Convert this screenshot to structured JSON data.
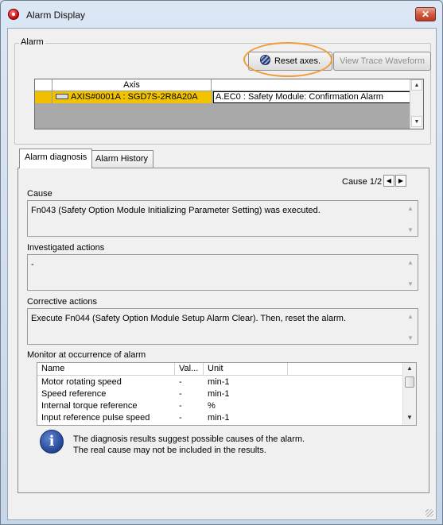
{
  "window": {
    "title": "Alarm Display",
    "close_glyph": "✕"
  },
  "alarm_group": {
    "label": "Alarm",
    "reset_button": "Reset axes.",
    "trace_button": "View Trace Waveform",
    "grid": {
      "header_axis": "Axis",
      "rows": [
        {
          "axis": "AXIS#0001A : SGD7S-2R8A20A",
          "alarm": "A.EC0 : Safety Module: Confirmation Alarm"
        }
      ]
    }
  },
  "tabs": [
    {
      "label": "Alarm diagnosis",
      "active": true
    },
    {
      "label": "Alarm History",
      "active": false
    }
  ],
  "diagnosis": {
    "cause_nav": "Cause 1/2",
    "cause_label": "Cause",
    "cause_text": "Fn043 (Safety Option Module Initializing Parameter Setting) was executed.",
    "investigated_label": "Investigated actions",
    "investigated_text": "-",
    "corrective_label": "Corrective actions",
    "corrective_text": "Execute Fn044 (Safety Option Module Setup Alarm Clear). Then, reset the alarm.",
    "monitor_label": "Monitor at occurrence of alarm",
    "monitor": {
      "columns": [
        "Name",
        "Val...",
        "Unit",
        ""
      ],
      "rows": [
        {
          "name": "Motor rotating speed",
          "value": "-",
          "unit": "min-1"
        },
        {
          "name": "Speed reference",
          "value": "-",
          "unit": "min-1"
        },
        {
          "name": "Internal torque reference",
          "value": "-",
          "unit": "%"
        },
        {
          "name": "Input reference pulse speed",
          "value": "-",
          "unit": "min-1"
        }
      ]
    },
    "info_line1": "The diagnosis results suggest possible causes of the alarm.",
    "info_line2": "The real cause may not be included in the results."
  },
  "icons": {
    "nav_prev": "◀",
    "nav_next": "▶",
    "scroll_up": "▲",
    "scroll_down": "▼",
    "info": "i"
  },
  "colors": {
    "alarm_row": "#f2c300",
    "highlight_ring": "#f19b3b"
  }
}
